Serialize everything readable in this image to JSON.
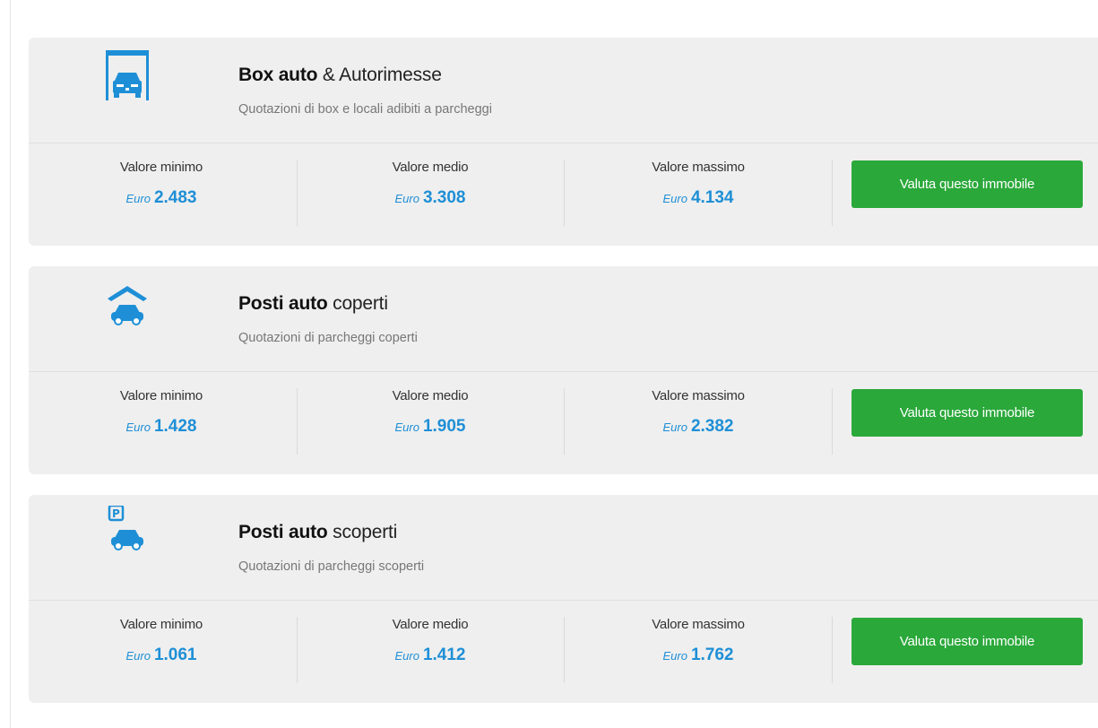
{
  "cards": [
    {
      "icon": "garage-box-icon",
      "title_bold": "Box auto",
      "title_rest": " & Autorimesse",
      "subtitle": "Quotazioni di box e locali adibiti a parcheggi",
      "min": {
        "label": "Valore minimo",
        "currency": "Euro",
        "value": "2.483"
      },
      "avg": {
        "label": "Valore medio",
        "currency": "Euro",
        "value": "3.308"
      },
      "max": {
        "label": "Valore massimo",
        "currency": "Euro",
        "value": "4.134"
      },
      "button": "Valuta questo immobile"
    },
    {
      "icon": "covered-parking-icon",
      "title_bold": "Posti auto",
      "title_rest": " coperti",
      "subtitle": "Quotazioni di parcheggi coperti",
      "min": {
        "label": "Valore minimo",
        "currency": "Euro",
        "value": "1.428"
      },
      "avg": {
        "label": "Valore medio",
        "currency": "Euro",
        "value": "1.905"
      },
      "max": {
        "label": "Valore massimo",
        "currency": "Euro",
        "value": "2.382"
      },
      "button": "Valuta questo immobile"
    },
    {
      "icon": "open-parking-icon",
      "title_bold": "Posti auto",
      "title_rest": " scoperti",
      "subtitle": "Quotazioni di parcheggi scoperti",
      "min": {
        "label": "Valore minimo",
        "currency": "Euro",
        "value": "1.061"
      },
      "avg": {
        "label": "Valore medio",
        "currency": "Euro",
        "value": "1.412"
      },
      "max": {
        "label": "Valore massimo",
        "currency": "Euro",
        "value": "1.762"
      },
      "button": "Valuta questo immobile"
    }
  ],
  "colors": {
    "accent": "#1e8fd6",
    "button": "#2aa83a",
    "card_bg": "#efefef"
  }
}
